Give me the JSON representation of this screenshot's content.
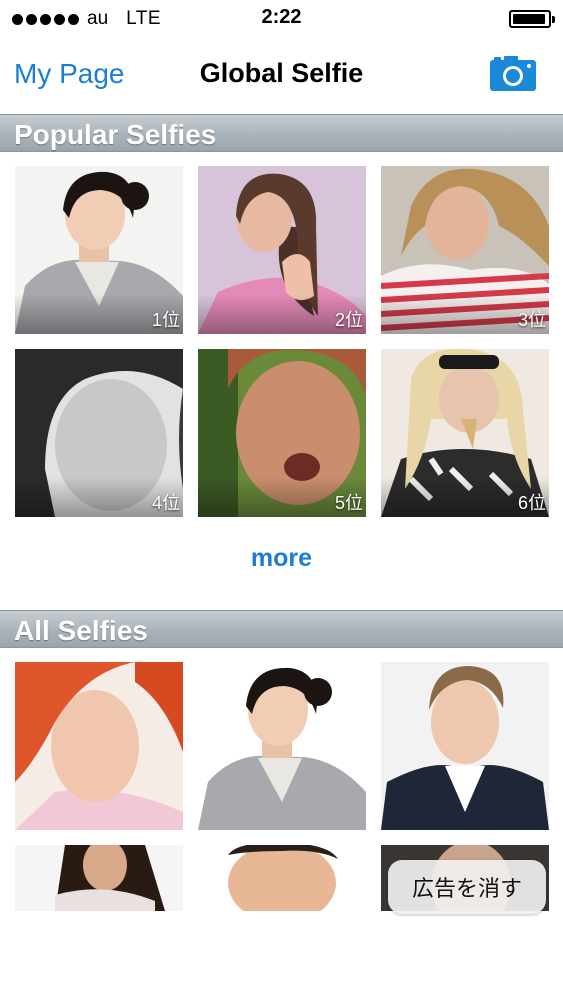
{
  "status_bar": {
    "carrier": "au",
    "network": "LTE",
    "time": "2:22",
    "battery_level": 0.95
  },
  "nav": {
    "left_label": "My Page",
    "title": "Global Selfie",
    "right_icon": "camera-icon"
  },
  "popular": {
    "header": "Popular Selfies",
    "items": [
      {
        "rank": "1位"
      },
      {
        "rank": "2位"
      },
      {
        "rank": "3位"
      },
      {
        "rank": "4位"
      },
      {
        "rank": "5位"
      },
      {
        "rank": "6位"
      }
    ],
    "more_label": "more"
  },
  "all": {
    "header": "All Selfies"
  },
  "ad": {
    "remove_label": "広告を消す"
  },
  "colors": {
    "accent": "#1a7fd4",
    "section_header": "#aab3ba"
  }
}
